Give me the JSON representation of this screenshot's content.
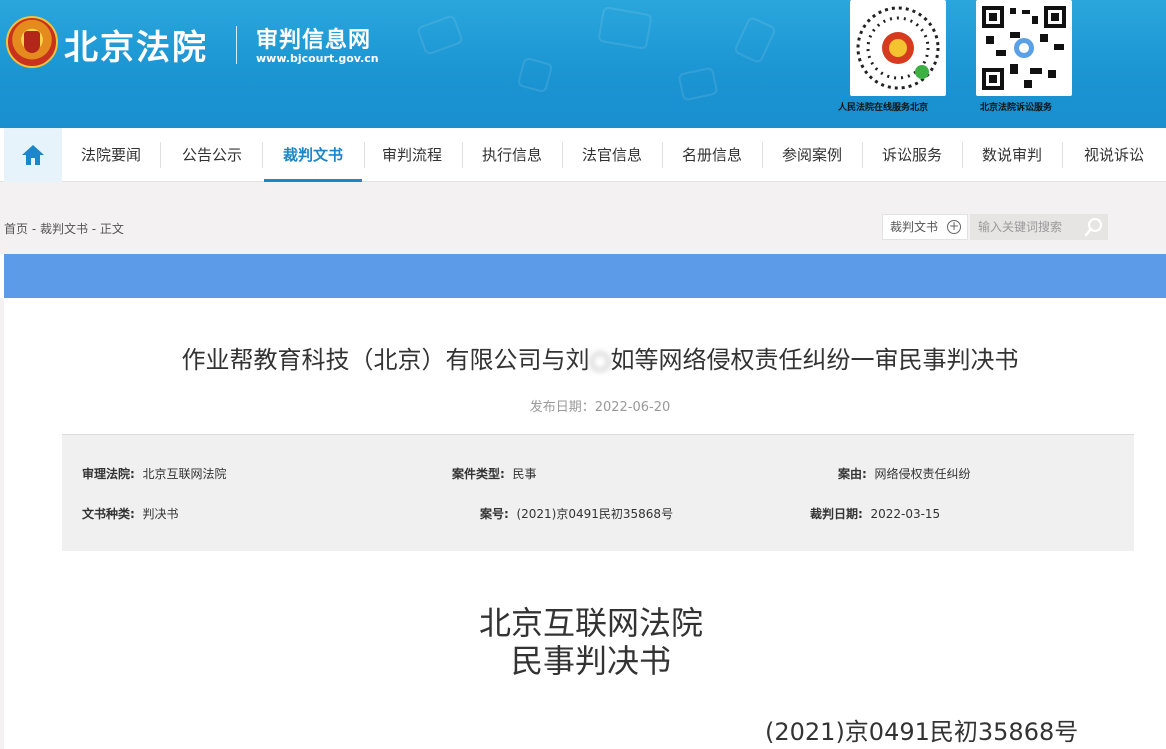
{
  "header": {
    "site_name": "北京法院",
    "sub_name": "审判信息网",
    "url": "www.bjcourt.gov.cn",
    "qr_codes": [
      {
        "label": "人民法院在线服务北京"
      },
      {
        "label": "北京法院诉讼服务"
      }
    ]
  },
  "nav": {
    "home_icon": "home-icon",
    "items": [
      "法院要闻",
      "公告公示",
      "裁判文书",
      "审判流程",
      "执行信息",
      "法官信息",
      "名册信息",
      "参阅案例",
      "诉讼服务",
      "数说审判",
      "视说诉讼"
    ],
    "active": "裁判文书"
  },
  "breadcrumb": "首页 - 裁判文书 - 正文",
  "search": {
    "type_label": "裁判文书",
    "placeholder": "输入关键词搜索"
  },
  "document": {
    "title_before": "作业帮教育科技（北京）有限公司与刘",
    "title_after": "如等网络侵权责任纠纷一审民事判决书",
    "publish_date": "发布日期：2022-06-20",
    "info": {
      "court_label": "审理法院:",
      "court_value": "北京互联网法院",
      "case_type_label": "案件类型:",
      "case_type_value": "民事",
      "cause_label": "案由:",
      "cause_value": "网络侵权责任纠纷",
      "doc_kind_label": "文书种类:",
      "doc_kind_value": "判决书",
      "case_no_label": "案号:",
      "case_no_value": "(2021)京0491民初35868号",
      "judgment_date_label": "裁判日期:",
      "judgment_date_value": "2022-03-15"
    },
    "court_name": "北京互联网法院",
    "doc_type": "民事判决书",
    "case_no": "(2021)京0491民初35868号"
  }
}
